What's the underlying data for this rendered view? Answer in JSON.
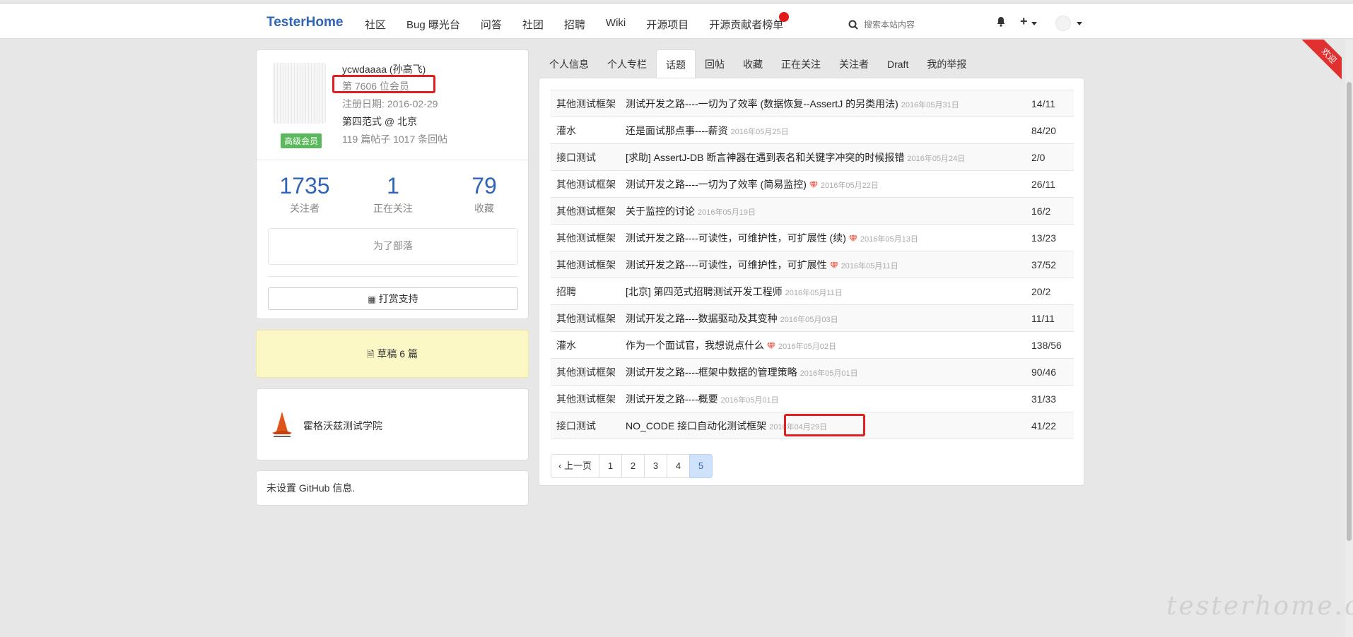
{
  "nav": {
    "brand": "TesterHome",
    "links": [
      "社区",
      "Bug 曝光台",
      "问答",
      "社团",
      "招聘",
      "Wiki",
      "开源项目",
      "开源贡献者榜单"
    ],
    "search_placeholder": "搜索本站内容",
    "notification_dot_color": "#e4191c"
  },
  "ribbon": {
    "label": "欢迎"
  },
  "profile": {
    "name": "ycwdaaaa (孙高飞)",
    "rank": "第 7606 位会员",
    "joined": "注册日期: 2016-02-29",
    "company": "第四范式 @ 北京",
    "posts": "119 篇帖子 1017 条回帖",
    "badge": "高级会员",
    "stats": [
      {
        "num": "1735",
        "label": "关注者"
      },
      {
        "num": "1",
        "label": "正在关注"
      },
      {
        "num": "79",
        "label": "收藏"
      }
    ],
    "tribe": "为了部落",
    "donate": "打赏支持"
  },
  "drafts": "草稿 6 篇",
  "school": "霍格沃兹测试学院",
  "github": "未设置 GitHub 信息.",
  "tabs": [
    "个人信息",
    "个人专栏",
    "话题",
    "回帖",
    "收藏",
    "正在关注",
    "关注者",
    "Draft",
    "我的举报"
  ],
  "active_tab": "话题",
  "topics": [
    {
      "node": "其他测试框架",
      "title": "测试开发之路----一切为了效率 (数据恢复--AssertJ 的另类用法)",
      "gem": false,
      "date": "2016年05月31日",
      "count": "14/11"
    },
    {
      "node": "灌水",
      "title": "还是面试那点事----薪资",
      "gem": false,
      "date": "2016年05月25日",
      "count": "84/20"
    },
    {
      "node": "接口测试",
      "title": "[求助] AssertJ-DB 断言神器在遇到表名和关键字冲突的时候报错",
      "gem": false,
      "date": "2016年05月24日",
      "count": "2/0"
    },
    {
      "node": "其他测试框架",
      "title": "测试开发之路----一切为了效率 (简易监控)",
      "gem": true,
      "date": "2016年05月22日",
      "count": "26/11"
    },
    {
      "node": "其他测试框架",
      "title": "关于监控的讨论",
      "gem": false,
      "date": "2016年05月19日",
      "count": "16/2"
    },
    {
      "node": "其他测试框架",
      "title": "测试开发之路----可读性，可维护性，可扩展性 (续)",
      "gem": true,
      "date": "2016年05月13日",
      "count": "13/23"
    },
    {
      "node": "其他测试框架",
      "title": "测试开发之路----可读性，可维护性，可扩展性",
      "gem": true,
      "date": "2016年05月11日",
      "count": "37/52"
    },
    {
      "node": "招聘",
      "title": "[北京] 第四范式招聘测试开发工程师",
      "gem": false,
      "date": "2016年05月11日",
      "count": "20/2"
    },
    {
      "node": "其他测试框架",
      "title": "测试开发之路----数据驱动及其变种",
      "gem": false,
      "date": "2016年05月03日",
      "count": "11/11"
    },
    {
      "node": "灌水",
      "title": "作为一个面试官，我想说点什么",
      "gem": true,
      "date": "2016年05月02日",
      "count": "138/56"
    },
    {
      "node": "其他测试框架",
      "title": "测试开发之路----框架中数据的管理策略",
      "gem": false,
      "date": "2016年05月01日",
      "count": "90/46"
    },
    {
      "node": "其他测试框架",
      "title": "测试开发之路----概要",
      "gem": false,
      "date": "2016年05月01日",
      "count": "31/33"
    },
    {
      "node": "接口测试",
      "title": "NO_CODE 接口自动化测试框架",
      "gem": false,
      "date": "2016年04月29日",
      "count": "41/22"
    }
  ],
  "pager": {
    "prev": "‹ 上一页",
    "pages": [
      "1",
      "2",
      "3",
      "4",
      "5"
    ],
    "current": "5"
  },
  "watermark": "testerhome.com",
  "colors": {
    "accent": "#2f64b6",
    "highlight": "#e02020",
    "drafts_bg": "#fcf8c6",
    "vip": "#5cb85c"
  }
}
